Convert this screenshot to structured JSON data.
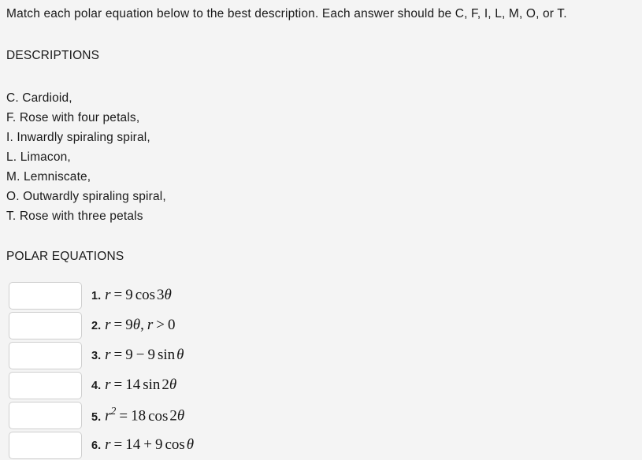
{
  "prompt": "Match each polar equation below to the best description. Each answer should be C, F, I, L, M, O, or T.",
  "descriptions_heading": "DESCRIPTIONS",
  "descriptions": [
    "C. Cardioid,",
    "F. Rose with four petals,",
    "I. Inwardly spiraling spiral,",
    "L. Limacon,",
    "M. Lemniscate,",
    "O. Outwardly spiraling spiral,",
    "T. Rose with three petals"
  ],
  "equations_heading": "POLAR EQUATIONS",
  "equations": [
    {
      "number": "1.",
      "equation": "r = 9 cos 3θ",
      "answer_value": "",
      "answer_placeholder": "",
      "parts": {
        "lhs": "r",
        "rel": "=",
        "coefficient": "9",
        "function": "cos",
        "argument_coefficient": "3",
        "variable": "θ"
      }
    },
    {
      "number": "2.",
      "equation": "r = 9θ, r > 0",
      "answer_value": "",
      "answer_placeholder": "",
      "parts": {
        "lhs": "r",
        "rel": "=",
        "coefficient": "9",
        "variable": "θ",
        "constraint_lhs": "r",
        "constraint_rel": ">",
        "constraint_rhs": "0"
      }
    },
    {
      "number": "3.",
      "equation": "r = 9 − 9 sin θ",
      "answer_value": "",
      "answer_placeholder": "",
      "parts": {
        "lhs": "r",
        "rel": "=",
        "term1": "9",
        "op": "−",
        "coefficient": "9",
        "function": "sin",
        "variable": "θ"
      }
    },
    {
      "number": "4.",
      "equation": "r = 14 sin 2θ",
      "answer_value": "",
      "answer_placeholder": "",
      "parts": {
        "lhs": "r",
        "rel": "=",
        "coefficient": "14",
        "function": "sin",
        "argument_coefficient": "2",
        "variable": "θ"
      }
    },
    {
      "number": "5.",
      "equation": "r² = 18 cos 2θ",
      "answer_value": "",
      "answer_placeholder": "",
      "parts": {
        "lhs": "r",
        "lhs_exponent": "2",
        "rel": "=",
        "coefficient": "18",
        "function": "cos",
        "argument_coefficient": "2",
        "variable": "θ"
      }
    },
    {
      "number": "6.",
      "equation": "r = 14 + 9 cos θ",
      "answer_value": "",
      "answer_placeholder": "",
      "parts": {
        "lhs": "r",
        "rel": "=",
        "term1": "14",
        "op": "+",
        "coefficient": "9",
        "function": "cos",
        "variable": "θ"
      }
    }
  ],
  "colors": {
    "background": "#f4f4f4",
    "text": "#1a1a1a",
    "input_background": "#ffffff",
    "input_border": "#cfcfcf"
  }
}
